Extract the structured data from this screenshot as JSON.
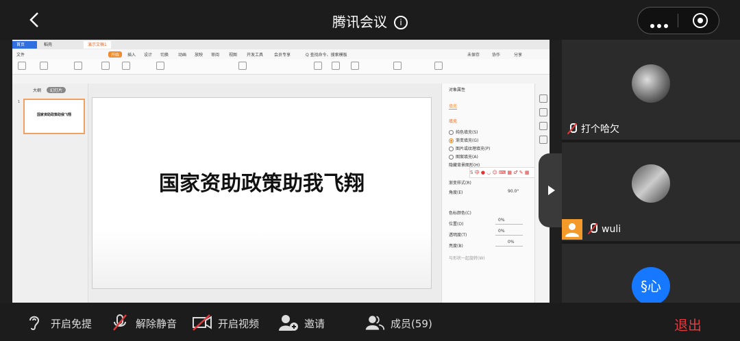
{
  "header": {
    "title": "腾讯会议",
    "info_symbol": "i"
  },
  "shared_screen": {
    "tabs": {
      "home": "首页",
      "tab2": "稻壳",
      "tab3": "演示文稿1"
    },
    "menu": {
      "file": "文件",
      "start": "开始",
      "items": [
        "插入",
        "设计",
        "切换",
        "动画",
        "放映",
        "审阅",
        "视图",
        "开发工具",
        "会员专享"
      ],
      "search": "Q 查找命令、搜索模板",
      "right": [
        "未保存",
        "协作",
        "分享"
      ]
    },
    "left_panel": {
      "tab_outline": "大纲",
      "tab_slides": "幻灯片",
      "slide_number": "1",
      "thumb_text": "国家资助政策助我飞翔"
    },
    "slide": {
      "title": "国家资助政策助我飞翔"
    },
    "right_panel": {
      "title": "对象属性",
      "tab": "填充",
      "section": "填充",
      "options": [
        "纯色填充(S)",
        "渐变填充(G)",
        "图片或纹理填充(P)",
        "图案填充(A)",
        "隐藏背景图形(H)"
      ],
      "ime_text": "S 中 ● ◡ ☺ ⌨ ▦ ♂ ✎ ▦",
      "gradient_style": "渐变样式(R)",
      "angle_label": "角度(E)",
      "angle_value": "90.0°",
      "color_stop": "色标颜色(C)",
      "position_label": "位置(O)",
      "position_value": "0%",
      "transparency_label": "透明度(T)",
      "transparency_value": "0%",
      "brightness_label": "亮度(B)",
      "brightness_value": "0%",
      "rotate_with": "与形状一起旋转(W)"
    }
  },
  "participants": [
    {
      "name": "打个哈欠",
      "muted": true
    },
    {
      "name": "wuli",
      "muted": true
    },
    {
      "name": "§心",
      "avatar_color": "#1677ff"
    }
  ],
  "bottom_bar": {
    "hearing_aid": "开启免提",
    "unmute": "解除静音",
    "video": "开启视频",
    "invite": "邀请",
    "members": "成员(59)",
    "exit": "退出"
  },
  "colors": {
    "exit": "#e5393d",
    "accent": "#f08c2e",
    "avatar_blue": "#1677ff"
  }
}
